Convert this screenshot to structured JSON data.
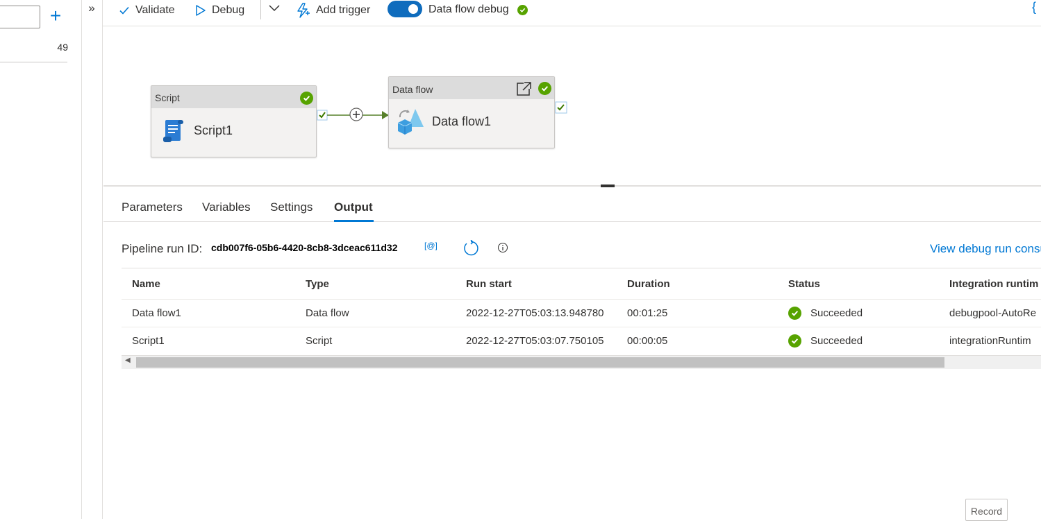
{
  "left_panel": {
    "count": "49"
  },
  "toolbar": {
    "validate_label": "Validate",
    "debug_label": "Debug",
    "add_trigger_label": "Add trigger",
    "dataflow_debug_label": "Data flow debug",
    "dataflow_debug_on": true,
    "code_brace": "{"
  },
  "canvas": {
    "nodes": [
      {
        "type_label": "Script",
        "name": "Script1",
        "status": "succeeded"
      },
      {
        "type_label": "Data flow",
        "name": "Data flow1",
        "status": "succeeded"
      }
    ]
  },
  "tabs": [
    {
      "label": "Parameters"
    },
    {
      "label": "Variables"
    },
    {
      "label": "Settings"
    },
    {
      "label": "Output",
      "active": true
    }
  ],
  "output": {
    "run_id_label": "Pipeline run ID:",
    "run_id": "cdb007f6-05b6-4420-8cb8-3dceac611d32",
    "copy_label": "[@]",
    "debug_link": "View debug run consu",
    "columns": [
      "Name",
      "Type",
      "Run start",
      "Duration",
      "Status",
      "Integration runtim"
    ],
    "rows": [
      {
        "name": "Data flow1",
        "type": "Data flow",
        "run_start": "2022-12-27T05:03:13.948780",
        "duration": "00:01:25",
        "status": "Succeeded",
        "runtime": "debugpool-AutoRe"
      },
      {
        "name": "Script1",
        "type": "Script",
        "run_start": "2022-12-27T05:03:07.750105",
        "duration": "00:00:05",
        "status": "Succeeded",
        "runtime": "integrationRuntim"
      }
    ]
  },
  "record_label": "Record",
  "colors": {
    "accent": "#0078d4",
    "success": "#57a300",
    "toggle_on": "#0f6cbd"
  }
}
